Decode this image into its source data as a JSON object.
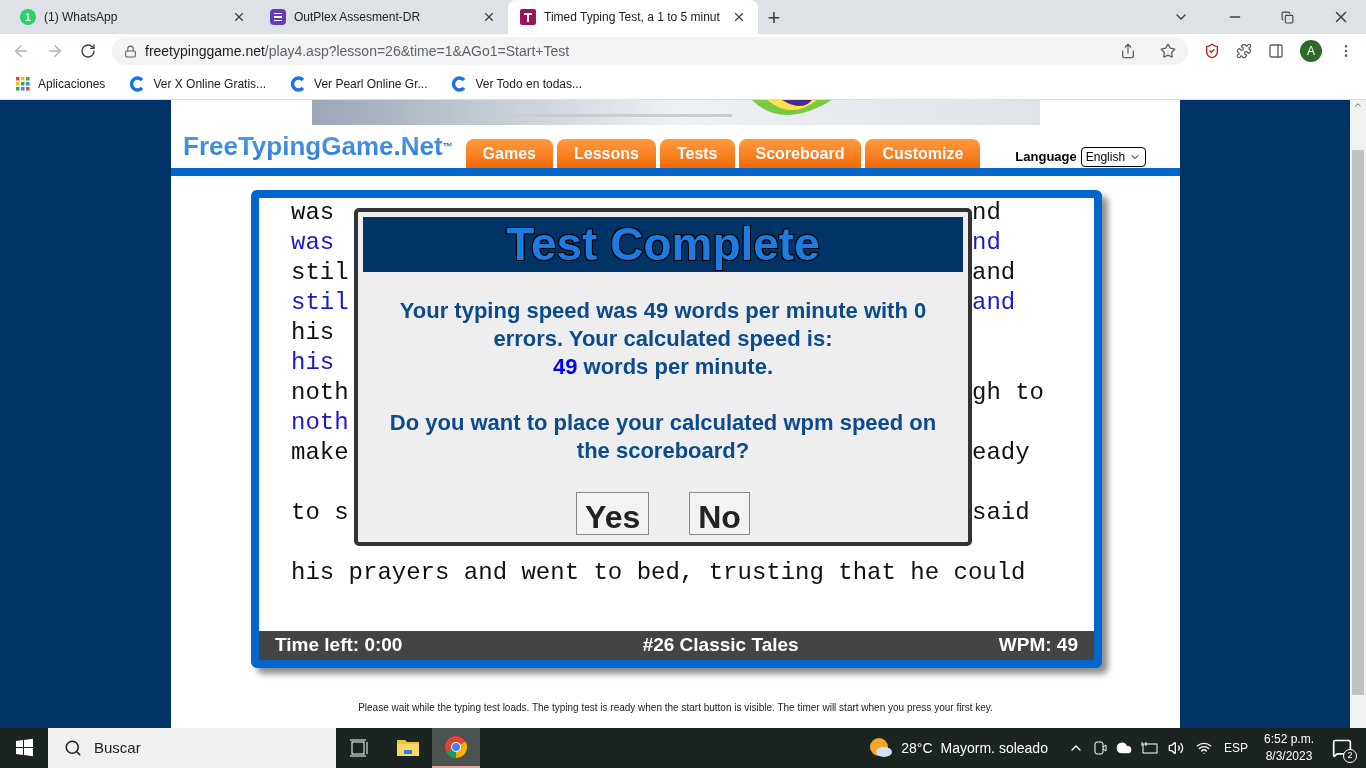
{
  "browser": {
    "tabs": [
      {
        "title": "(1) WhatsApp",
        "badge": "1",
        "kind": "whatsapp",
        "selected": false
      },
      {
        "title": "OutPlex Assesment-DR",
        "kind": "forms",
        "selected": false
      },
      {
        "title": "Timed Typing Test, a 1 to 5 minut",
        "kind": "typing",
        "selected": true
      }
    ],
    "new_tab": "+",
    "url_host": "freetypinggame.net",
    "url_path": "/play4.asp?lesson=26&time=1&AGo1=Start+Test",
    "profile": "A",
    "bookmarks": [
      "Aplicaciones",
      "Ver X Online Gratis...",
      "Ver Pearl Online Gr...",
      "Ver Todo en todas..."
    ]
  },
  "site": {
    "logo": "FreeTypingGame.Net",
    "logo_mark": "™",
    "nav": [
      "Games",
      "Lessons",
      "Tests",
      "Scoreboard",
      "Customize"
    ],
    "language_label": "Language",
    "language": "English"
  },
  "test": {
    "lines": [
      {
        "kind": "source",
        "left": "was",
        "right": "nd"
      },
      {
        "kind": "typed",
        "left": "was",
        "right": "nd"
      },
      {
        "kind": "source",
        "left": "stil",
        "right": "and"
      },
      {
        "kind": "typed",
        "left": "stil",
        "right": "and"
      },
      {
        "kind": "source",
        "left": "his"
      },
      {
        "kind": "typed",
        "left": "his"
      },
      {
        "kind": "source",
        "left": "noth",
        "right": "gh to"
      },
      {
        "kind": "typed",
        "left": "noth"
      },
      {
        "kind": "source",
        "left": "make",
        "right": "eady"
      },
      {
        "kind": "blank"
      },
      {
        "kind": "source",
        "left": "to s",
        "right": "said"
      },
      {
        "kind": "blank"
      },
      {
        "kind": "source",
        "left": "his prayers and went to bed, trusting that he could"
      }
    ],
    "status": {
      "time_left": "Time left: 0:00",
      "lesson": "#26 Classic Tales",
      "wpm": "WPM: 49"
    }
  },
  "dialog": {
    "title": "Test Complete",
    "message": "Your typing speed was 49 words per minute with 0 errors. Your calculated speed is:",
    "speed": "49",
    "speed_unit": "words per minute.",
    "question": "Do you want to place your calculated wpm speed on the scoreboard?",
    "buttons": [
      "Yes",
      "No"
    ]
  },
  "notice": "Please wait while the typing test loads. The typing test is ready when the start button is visible. The timer will start when you press your first key.",
  "taskbar": {
    "search": "Buscar",
    "temperature": "28°C",
    "weather": "Mayorm. soleado",
    "language": "ESP",
    "time": "6:52 p.m.",
    "date": "8/3/2023",
    "notifications": "2"
  }
}
